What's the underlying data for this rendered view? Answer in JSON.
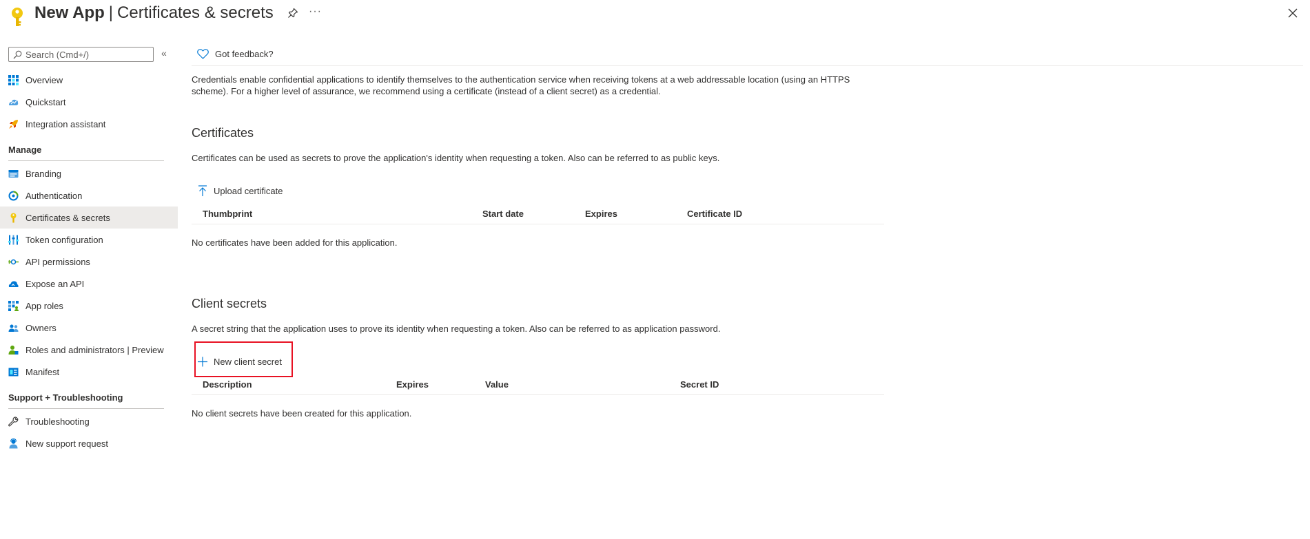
{
  "header": {
    "app_name": "New App",
    "separator": "|",
    "page_title": "Certificates & secrets",
    "more_label": "···"
  },
  "sidebar": {
    "search_placeholder": "Search (Cmd+/)",
    "collapse_label": "«",
    "items": [
      {
        "label": "Overview",
        "icon": "overview-icon"
      },
      {
        "label": "Quickstart",
        "icon": "quickstart-icon"
      },
      {
        "label": "Integration assistant",
        "icon": "rocket-icon"
      },
      {
        "label": "Branding",
        "icon": "branding-icon"
      },
      {
        "label": "Authentication",
        "icon": "authentication-icon"
      },
      {
        "label": "Certificates & secrets",
        "icon": "key-icon",
        "selected": true
      },
      {
        "label": "Token configuration",
        "icon": "token-config-icon"
      },
      {
        "label": "API permissions",
        "icon": "api-permissions-icon"
      },
      {
        "label": "Expose an API",
        "icon": "cloud-icon"
      },
      {
        "label": "App roles",
        "icon": "app-roles-icon"
      },
      {
        "label": "Owners",
        "icon": "owners-icon"
      },
      {
        "label": "Roles and administrators | Preview",
        "icon": "roles-admin-icon"
      },
      {
        "label": "Manifest",
        "icon": "manifest-icon"
      },
      {
        "label": "Troubleshooting",
        "icon": "wrench-icon"
      },
      {
        "label": "New support request",
        "icon": "support-person-icon"
      }
    ],
    "sections": {
      "manage": "Manage",
      "support": "Support + Troubleshooting"
    }
  },
  "main": {
    "feedback_label": "Got feedback?",
    "intro": "Credentials enable confidential applications to identify themselves to the authentication service when receiving tokens at a web addressable location (using an HTTPS scheme). For a higher level of assurance, we recommend using a certificate (instead of a client secret) as a credential.",
    "certificates": {
      "heading": "Certificates",
      "description": "Certificates can be used as secrets to prove the application's identity when requesting a token. Also can be referred to as public keys.",
      "upload_label": "Upload certificate",
      "columns": [
        "Thumbprint",
        "Start date",
        "Expires",
        "Certificate ID"
      ],
      "empty": "No certificates have been added for this application."
    },
    "client_secrets": {
      "heading": "Client secrets",
      "description": "A secret string that the application uses to prove its identity when requesting a token. Also can be referred to as application password.",
      "new_label": "New client secret",
      "columns": [
        "Description",
        "Expires",
        "Value",
        "Secret ID"
      ],
      "empty": "No client secrets have been created for this application."
    }
  },
  "colors": {
    "accent": "#0078d4",
    "key_yellow": "#f2c811",
    "highlight": "#e81123",
    "selected_bg": "#edebe9"
  }
}
